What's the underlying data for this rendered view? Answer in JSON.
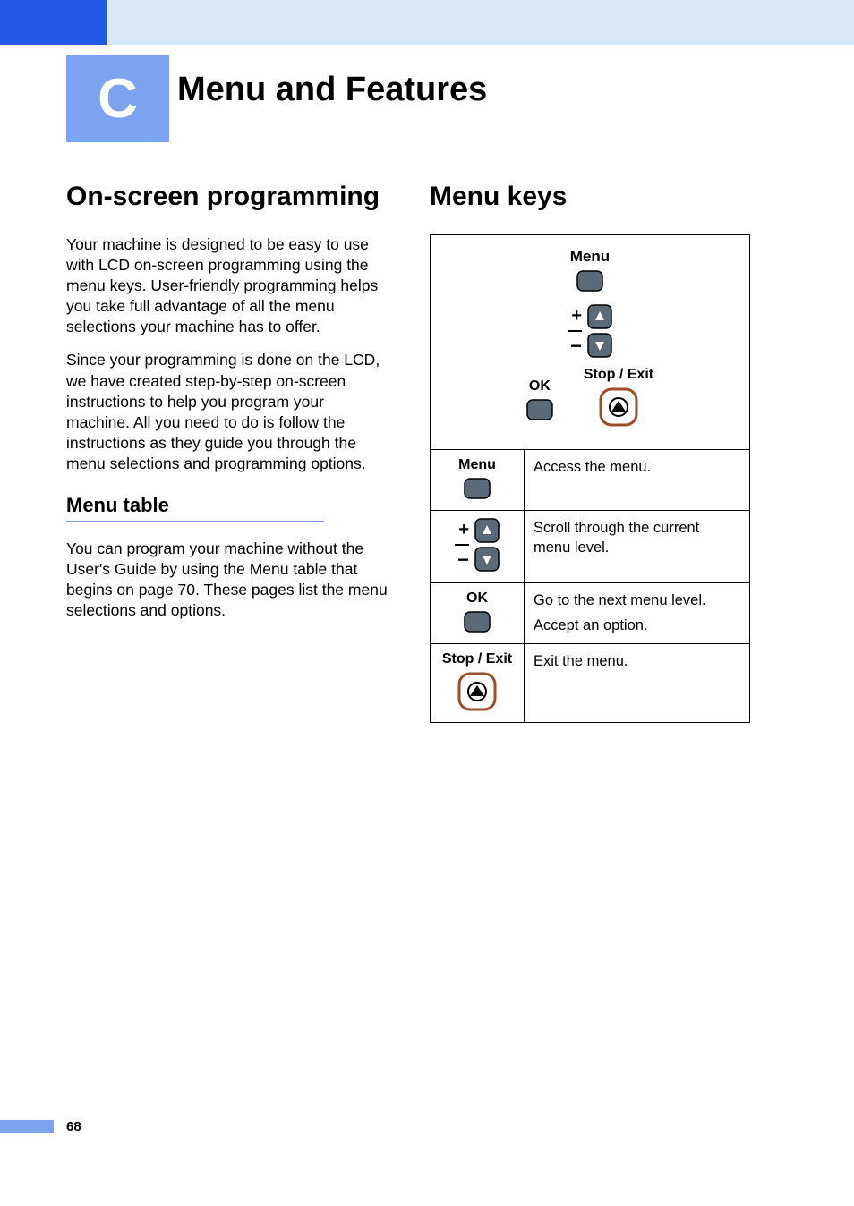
{
  "section_letter": "C",
  "section_title": "Menu and Features",
  "left": {
    "heading": "On-screen programming",
    "para1": "Your machine is designed to be easy to use with LCD on-screen programming using the menu keys. User-friendly programming helps you take full advantage of all the menu selections your machine has to offer.",
    "para2": "Since your programming is done on the LCD, we have created step-by-step on-screen instructions to help you program your machine. All you need to do is follow the instructions as they guide you through the menu selections and programming options.",
    "sub_heading": "Menu table",
    "sub_para": "You can program your machine without the User's Guide by using the Menu table that begins on page 70. These pages list the menu selections and options."
  },
  "right": {
    "heading": "Menu keys",
    "overview": {
      "menu_label": "Menu",
      "ok_label": "OK",
      "stop_label": "Stop / Exit"
    },
    "rows": [
      {
        "label": "Menu",
        "desc": "Access the menu."
      },
      {
        "label_plus": "+",
        "label_minus": "−",
        "desc": "Scroll through the current menu level."
      },
      {
        "label": "OK",
        "desc_line1": "Go to the next menu level.",
        "desc_line2": "Accept an option."
      },
      {
        "label": "Stop / Exit",
        "desc": "Exit the menu."
      }
    ]
  },
  "page_number": "68"
}
